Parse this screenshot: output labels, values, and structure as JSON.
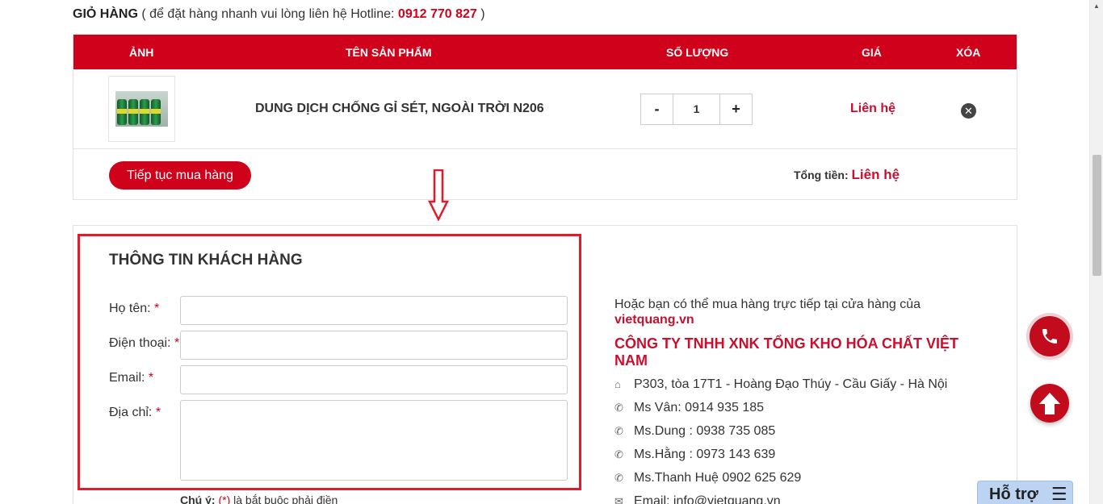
{
  "cart": {
    "title": "GIỎ HÀNG",
    "subtitle_pre": "( để đặt hàng nhanh vui lòng liên hệ Hotline:",
    "hotline": "0912 770 827",
    "subtitle_post": ")",
    "columns": [
      "ẢNH",
      "TÊN SẢN PHẨM",
      "SỐ LƯỢNG",
      "GIÁ",
      "XÓA"
    ],
    "item": {
      "name": "DUNG DỊCH CHỐNG GỈ SÉT, NGOÀI TRỜI N206",
      "quantity": "1",
      "price": "Liên hệ",
      "minus": "-",
      "plus": "+",
      "remove": "✕"
    },
    "continue_label": "Tiếp tục mua hàng",
    "total_label": "Tổng tiền:",
    "total_value": "Liên hệ"
  },
  "form": {
    "title": "THÔNG TIN KHÁCH HÀNG",
    "fields": [
      {
        "label": "Họ tên:"
      },
      {
        "label": "Điện thoại:"
      },
      {
        "label": "Email:"
      },
      {
        "label": "Địa chỉ:"
      }
    ],
    "required_mark": "*",
    "note_label": "Chú ý:",
    "note_mark": "(*)",
    "note_text": "là bắt buộc phải điền"
  },
  "store": {
    "intro": "Hoặc bạn có thể mua hàng trực tiếp tại cửa hàng của",
    "link": "vietquang.vn",
    "company": "CÔNG TY TNHH XNK TỔNG KHO HÓA CHẤT VIỆT NAM",
    "contacts": [
      {
        "icon": "home-icon",
        "text": "P303, tòa 17T1 - Hoàng Đạo Thúy - Cầu Giấy - Hà Nội"
      },
      {
        "icon": "phone-icon",
        "text": "Ms Vân: 0914 935 185"
      },
      {
        "icon": "phone-icon",
        "text": "Ms.Dung : 0938 735 085"
      },
      {
        "icon": "phone-icon",
        "text": "Ms.Hằng : 0973 143 639"
      },
      {
        "icon": "phone-icon",
        "text": "Ms.Thanh Huệ 0902 625 629"
      },
      {
        "icon": "envelope-icon",
        "text": "Email: info@vietquang.vn"
      }
    ]
  },
  "support": {
    "label": "Hỗ trợ",
    "menu_glyph": "☰"
  },
  "colors": {
    "brand_red": "#d0021b",
    "price_red": "#c8102e",
    "highlight": "#e21b2b",
    "support_bg": "#bcd4f2"
  }
}
